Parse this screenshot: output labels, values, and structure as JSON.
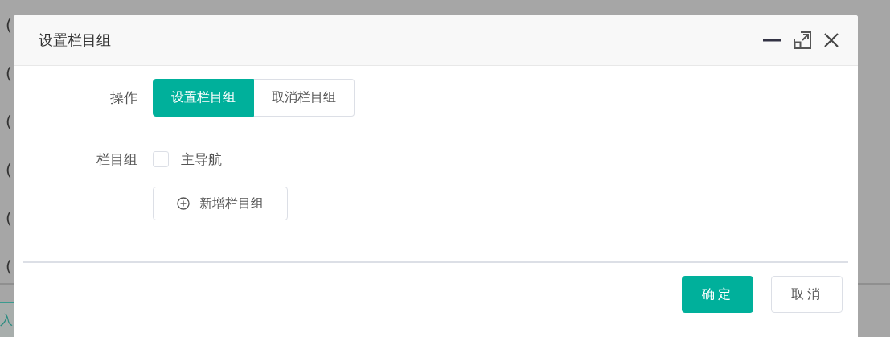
{
  "background": {
    "rows": [
      "(",
      "(",
      "(",
      "(",
      "(",
      "("
    ],
    "bottom_button": "入"
  },
  "dialog": {
    "title": "设置栏目组",
    "fields": [
      {
        "kind": "segmented",
        "label": "操作",
        "options": [
          {
            "label": "设置栏目组",
            "selected": true
          },
          {
            "label": "取消栏目组",
            "selected": false
          }
        ]
      },
      {
        "kind": "checkboxes",
        "label": "栏目组",
        "items": [
          {
            "label": "主导航",
            "checked": false
          }
        ],
        "add_button": "新增栏目组"
      }
    ],
    "buttons": [
      {
        "label": "确定",
        "kind": "primary"
      },
      {
        "label": "取消",
        "kind": "default"
      }
    ]
  }
}
